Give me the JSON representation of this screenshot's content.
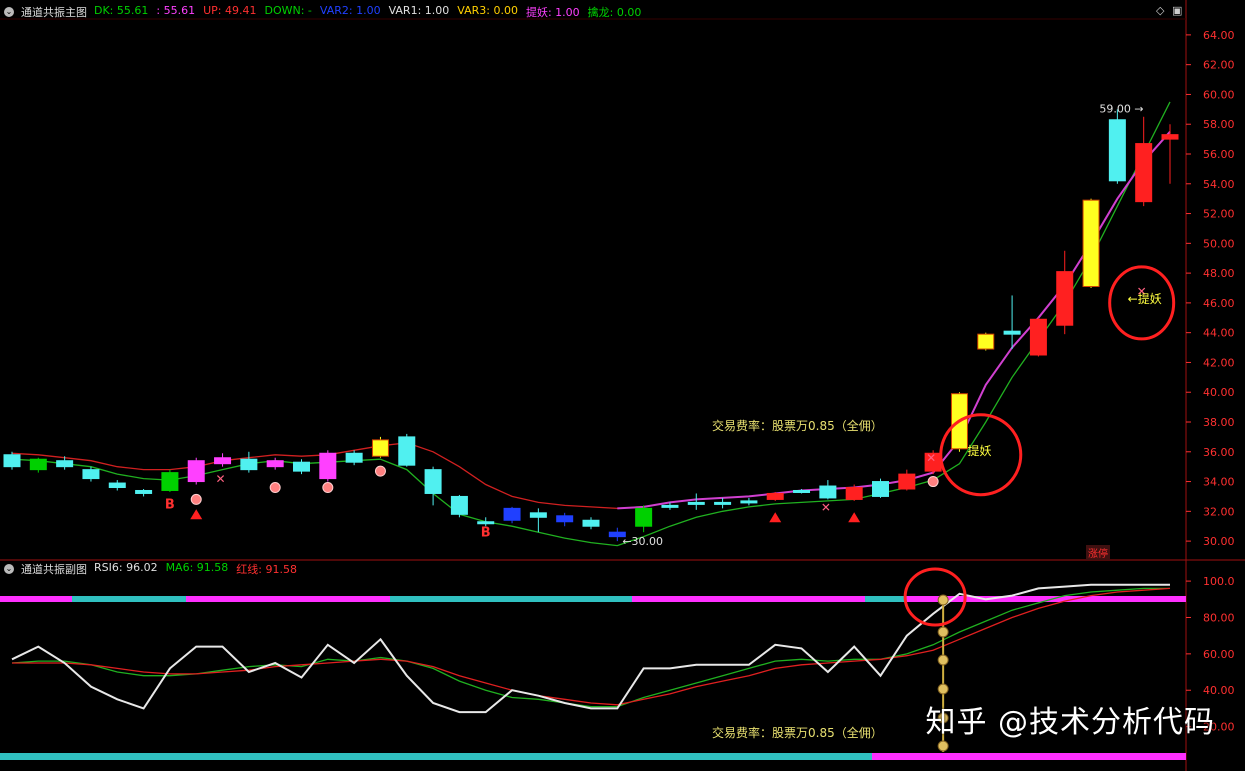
{
  "main_header": {
    "title": "通道共振主图",
    "items": [
      {
        "label": "DK: 55.61",
        "color": "#00d000"
      },
      {
        "label": ": 55.61",
        "color": "#ff40ff"
      },
      {
        "label": "UP: 49.41",
        "color": "#ff3030"
      },
      {
        "label": "DOWN: -",
        "color": "#00d000"
      },
      {
        "label": "VAR2: 1.00",
        "color": "#2040ff"
      },
      {
        "label": "VAR1: 1.00",
        "color": "#e0e0e0"
      },
      {
        "label": "VAR3: 0.00",
        "color": "#ffd000"
      },
      {
        "label": "提妖: 1.00",
        "color": "#ff40ff"
      },
      {
        "label": "擒龙: 0.00",
        "color": "#00d000"
      }
    ]
  },
  "sub_header": {
    "title": "通道共振副图",
    "items": [
      {
        "label": "RSI6: 96.02",
        "color": "#e0e0e0"
      },
      {
        "label": "MA6: 91.58",
        "color": "#00d000"
      },
      {
        "label": "红线: 91.58",
        "color": "#ff3030"
      }
    ]
  },
  "main_axis_ticks": [
    "64.00",
    "62.00",
    "60.00",
    "58.00",
    "56.00",
    "54.00",
    "52.00",
    "50.00",
    "48.00",
    "46.00",
    "44.00",
    "42.00",
    "40.00",
    "38.00",
    "36.00",
    "34.00",
    "32.00",
    "30.00"
  ],
  "sub_axis_ticks": [
    "100.0",
    "80.00",
    "60.00",
    "40.00",
    "20.00"
  ],
  "annotations": {
    "high_price": "59.00",
    "low_price": "←30.00",
    "tiyao_label": "提妖",
    "tiyao_arrow_label": "←提妖",
    "fee_text": "交易费率：股票万0.85（全佣）",
    "zhangting_tag": "涨停",
    "buy_marker": "B"
  },
  "watermark": "知乎 @技术分析代码",
  "colors": {
    "up_candle": "#ff2020",
    "down_candle": "#50f0f0",
    "yellow_candle": "#ffff20",
    "magenta_candle": "#ff40ff",
    "blue_candle": "#2040ff",
    "green_candle": "#00d000",
    "circle": "#ff2020"
  },
  "chart_data": {
    "type": "candlestick",
    "price_range": [
      29,
      65
    ],
    "rsi_range": [
      0,
      105
    ],
    "candles": [
      {
        "o": 35.8,
        "c": 35.0,
        "h": 36.0,
        "l": 34.8,
        "color": "cyan"
      },
      {
        "o": 35.5,
        "c": 34.8,
        "h": 35.6,
        "l": 34.6,
        "color": "green"
      },
      {
        "o": 35.4,
        "c": 35.0,
        "h": 35.7,
        "l": 34.8,
        "color": "cyan"
      },
      {
        "o": 34.8,
        "c": 34.2,
        "h": 35.0,
        "l": 34.0,
        "color": "cyan"
      },
      {
        "o": 33.9,
        "c": 33.6,
        "h": 34.1,
        "l": 33.4,
        "color": "cyan"
      },
      {
        "o": 33.4,
        "c": 33.2,
        "h": 33.5,
        "l": 33.0,
        "color": "cyan"
      },
      {
        "o": 33.4,
        "c": 34.6,
        "h": 34.8,
        "l": 33.3,
        "color": "green"
      },
      {
        "o": 34.0,
        "c": 35.4,
        "h": 35.6,
        "l": 33.8,
        "color": "magenta"
      },
      {
        "o": 35.2,
        "c": 35.6,
        "h": 35.9,
        "l": 35.0,
        "color": "magenta"
      },
      {
        "o": 35.5,
        "c": 34.8,
        "h": 36.0,
        "l": 34.6,
        "color": "cyan"
      },
      {
        "o": 35.0,
        "c": 35.4,
        "h": 35.6,
        "l": 34.8,
        "color": "magenta"
      },
      {
        "o": 35.3,
        "c": 34.7,
        "h": 35.5,
        "l": 34.5,
        "color": "cyan"
      },
      {
        "o": 34.2,
        "c": 35.9,
        "h": 36.1,
        "l": 34.0,
        "color": "magenta"
      },
      {
        "o": 35.9,
        "c": 35.3,
        "h": 36.1,
        "l": 35.1,
        "color": "cyan"
      },
      {
        "o": 35.7,
        "c": 36.8,
        "h": 37.0,
        "l": 35.6,
        "color": "yellow"
      },
      {
        "o": 37.0,
        "c": 35.1,
        "h": 37.2,
        "l": 35.0,
        "color": "cyan"
      },
      {
        "o": 34.8,
        "c": 33.2,
        "h": 35.0,
        "l": 32.4,
        "color": "cyan"
      },
      {
        "o": 33.0,
        "c": 31.8,
        "h": 33.1,
        "l": 31.6,
        "color": "cyan"
      },
      {
        "o": 31.3,
        "c": 31.2,
        "h": 31.6,
        "l": 31.0,
        "color": "cyan"
      },
      {
        "o": 32.2,
        "c": 31.4,
        "h": 32.3,
        "l": 31.2,
        "color": "blue"
      },
      {
        "o": 31.9,
        "c": 31.6,
        "h": 32.2,
        "l": 30.6,
        "color": "cyan"
      },
      {
        "o": 31.7,
        "c": 31.3,
        "h": 31.9,
        "l": 31.0,
        "color": "blue"
      },
      {
        "o": 31.4,
        "c": 31.0,
        "h": 31.6,
        "l": 30.8,
        "color": "cyan"
      },
      {
        "o": 30.6,
        "c": 30.3,
        "h": 30.9,
        "l": 30.0,
        "color": "blue"
      },
      {
        "o": 31.0,
        "c": 32.2,
        "h": 32.4,
        "l": 30.6,
        "color": "green"
      },
      {
        "o": 32.3,
        "c": 32.4,
        "h": 32.6,
        "l": 32.1,
        "color": "cyan"
      },
      {
        "o": 32.6,
        "c": 32.6,
        "h": 33.2,
        "l": 32.1,
        "color": "cyan"
      },
      {
        "o": 32.6,
        "c": 32.5,
        "h": 32.9,
        "l": 32.2,
        "color": "cyan"
      },
      {
        "o": 32.7,
        "c": 32.6,
        "h": 32.9,
        "l": 32.4,
        "color": "cyan"
      },
      {
        "o": 32.8,
        "c": 33.2,
        "h": 33.3,
        "l": 32.7,
        "color": "red"
      },
      {
        "o": 33.4,
        "c": 33.3,
        "h": 33.5,
        "l": 33.2,
        "color": "cyan"
      },
      {
        "o": 33.7,
        "c": 32.9,
        "h": 34.1,
        "l": 32.8,
        "color": "cyan"
      },
      {
        "o": 32.8,
        "c": 33.6,
        "h": 33.8,
        "l": 32.7,
        "color": "red"
      },
      {
        "o": 34.0,
        "c": 33.0,
        "h": 34.2,
        "l": 32.9,
        "color": "cyan"
      },
      {
        "o": 33.5,
        "c": 34.5,
        "h": 34.8,
        "l": 33.4,
        "color": "red"
      },
      {
        "o": 34.7,
        "c": 35.9,
        "h": 36.1,
        "l": 34.5,
        "color": "red"
      },
      {
        "o": 36.2,
        "c": 39.9,
        "h": 40.0,
        "l": 36.0,
        "color": "yellow"
      },
      {
        "o": 42.9,
        "c": 43.9,
        "h": 44.0,
        "l": 42.8,
        "color": "yellow"
      },
      {
        "o": 44.1,
        "c": 43.9,
        "h": 46.5,
        "l": 42.9,
        "color": "cyan"
      },
      {
        "o": 42.5,
        "c": 44.9,
        "h": 45.0,
        "l": 42.4,
        "color": "red"
      },
      {
        "o": 44.5,
        "c": 48.1,
        "h": 49.5,
        "l": 43.9,
        "color": "red"
      },
      {
        "o": 47.1,
        "c": 52.9,
        "h": 53.0,
        "l": 47.0,
        "color": "yellow"
      },
      {
        "o": 54.2,
        "c": 58.3,
        "h": 59.0,
        "l": 54.0,
        "color": "cyan"
      },
      {
        "o": 52.8,
        "c": 56.7,
        "h": 58.5,
        "l": 52.5,
        "color": "red"
      },
      {
        "o": 57.0,
        "c": 57.3,
        "h": 58.0,
        "l": 54.0,
        "color": "red"
      }
    ],
    "upper_line": [
      35.9,
      35.8,
      35.6,
      35.4,
      35.0,
      34.8,
      34.8,
      35.0,
      35.4,
      35.6,
      35.8,
      35.7,
      35.8,
      36.1,
      36.4,
      36.6,
      36.0,
      35.0,
      33.8,
      33.0,
      32.6,
      32.4,
      32.3,
      32.2,
      32.3,
      32.6,
      32.8,
      32.9,
      33.0,
      33.2,
      33.4,
      33.5,
      33.6,
      33.8,
      34.1,
      34.6,
      36.8,
      40.5,
      43.0,
      45.0,
      47.2,
      50.0,
      53.0,
      55.5,
      57.5
    ],
    "lower_line": [
      35.5,
      35.4,
      35.2,
      35.0,
      34.5,
      34.2,
      34.1,
      34.4,
      34.8,
      35.2,
      35.4,
      35.2,
      35.3,
      35.4,
      35.5,
      34.8,
      33.2,
      31.8,
      31.3,
      31.0,
      30.6,
      30.2,
      29.9,
      29.7,
      30.3,
      31.0,
      31.6,
      32.0,
      32.3,
      32.5,
      32.6,
      32.7,
      32.8,
      33.2,
      33.6,
      34.1,
      35.2,
      38.0,
      41.0,
      43.5,
      46.0,
      49.0,
      52.5,
      56.0,
      59.5
    ],
    "rsi6": [
      57,
      64,
      55,
      42,
      35,
      30,
      52,
      64,
      64,
      50,
      55,
      47,
      65,
      55,
      68,
      48,
      33,
      28,
      28,
      40,
      37,
      33,
      30,
      30,
      52,
      52,
      54,
      54,
      54,
      65,
      63,
      50,
      64,
      48,
      70,
      82,
      93,
      90,
      92,
      96,
      97,
      98,
      98,
      98,
      98
    ],
    "ma6": [
      55,
      56,
      56,
      54,
      50,
      48,
      48,
      49,
      51,
      53,
      54,
      53,
      57,
      56,
      58,
      56,
      52,
      45,
      40,
      36,
      35,
      33,
      31,
      31,
      36,
      40,
      44,
      48,
      52,
      56,
      57,
      56,
      57,
      57,
      60,
      65,
      72,
      78,
      84,
      88,
      92,
      94,
      95,
      96,
      96
    ],
    "red_line": [
      55,
      55,
      55,
      54,
      52,
      50,
      49,
      49,
      50,
      51,
      53,
      54,
      55,
      56,
      57,
      56,
      53,
      48,
      44,
      40,
      37,
      35,
      33,
      32,
      35,
      38,
      42,
      45,
      48,
      52,
      54,
      55,
      56,
      57,
      59,
      62,
      68,
      74,
      80,
      85,
      89,
      92,
      94,
      95,
      96
    ]
  }
}
